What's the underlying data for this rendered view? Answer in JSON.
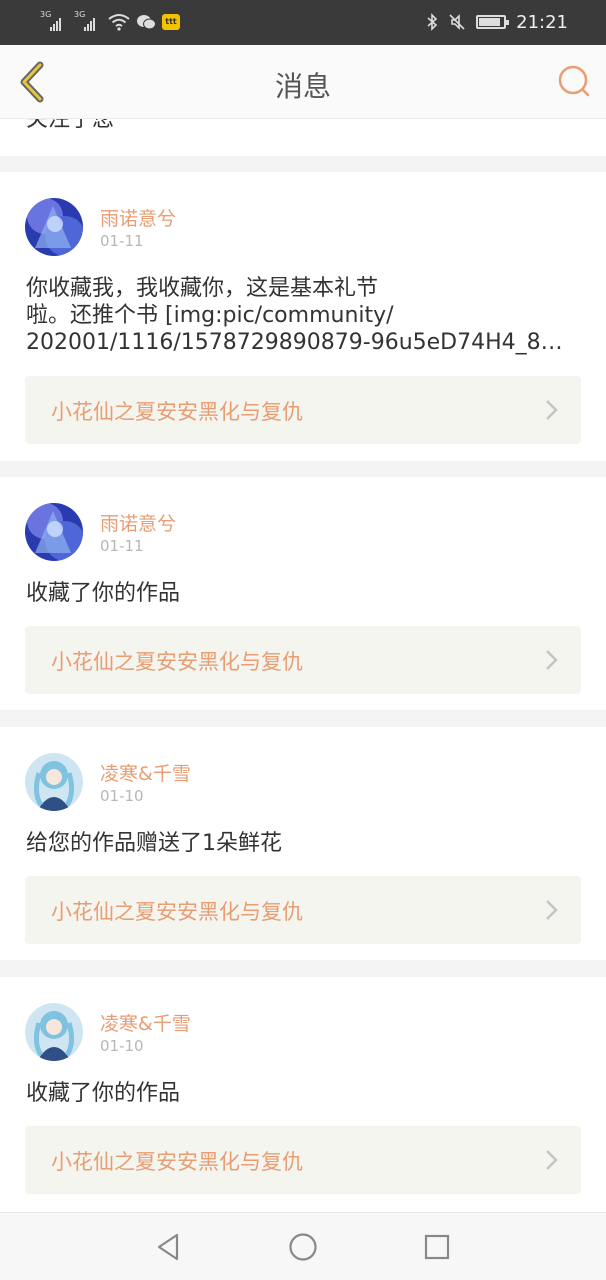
{
  "status_bar": {
    "network_1": "3G",
    "network_2": "3G",
    "time": "21:21",
    "battery_level": 0.8,
    "icons": [
      "signal-icon",
      "signal-icon",
      "wifi-icon",
      "wechat-icon",
      "app-badge-icon",
      "bluetooth-icon",
      "mute-icon",
      "battery-icon"
    ]
  },
  "header": {
    "title": "消息",
    "back_icon": "chevron-left-icon",
    "search_icon": "search-icon",
    "accent_color": "#e89d73"
  },
  "partial_item": {
    "text": "关注了您"
  },
  "messages": [
    {
      "user": "雨诺意兮",
      "date": "01-11",
      "text_lines": [
        "你收藏我，我收藏你，这是基本礼节",
        "啦。还推个书 [img:pic/community/",
        "202001/1116/1578729890879-96u5eD74H4_8…"
      ],
      "work_title": "小花仙之夏安安黑化与复仇"
    },
    {
      "user": "雨诺意兮",
      "date": "01-11",
      "text_lines": [
        "收藏了你的作品"
      ],
      "work_title": "小花仙之夏安安黑化与复仇"
    },
    {
      "user": "凌寒&千雪",
      "date": "01-10",
      "text_lines": [
        "给您的作品赠送了1朵鲜花"
      ],
      "work_title": "小花仙之夏安安黑化与复仇"
    },
    {
      "user": "凌寒&千雪",
      "date": "01-10",
      "text_lines": [
        "收藏了你的作品"
      ],
      "work_title": "小花仙之夏安安黑化与复仇"
    }
  ],
  "nav_bar": {
    "icons": [
      "back-triangle-icon",
      "home-circle-icon",
      "recents-square-icon"
    ]
  }
}
